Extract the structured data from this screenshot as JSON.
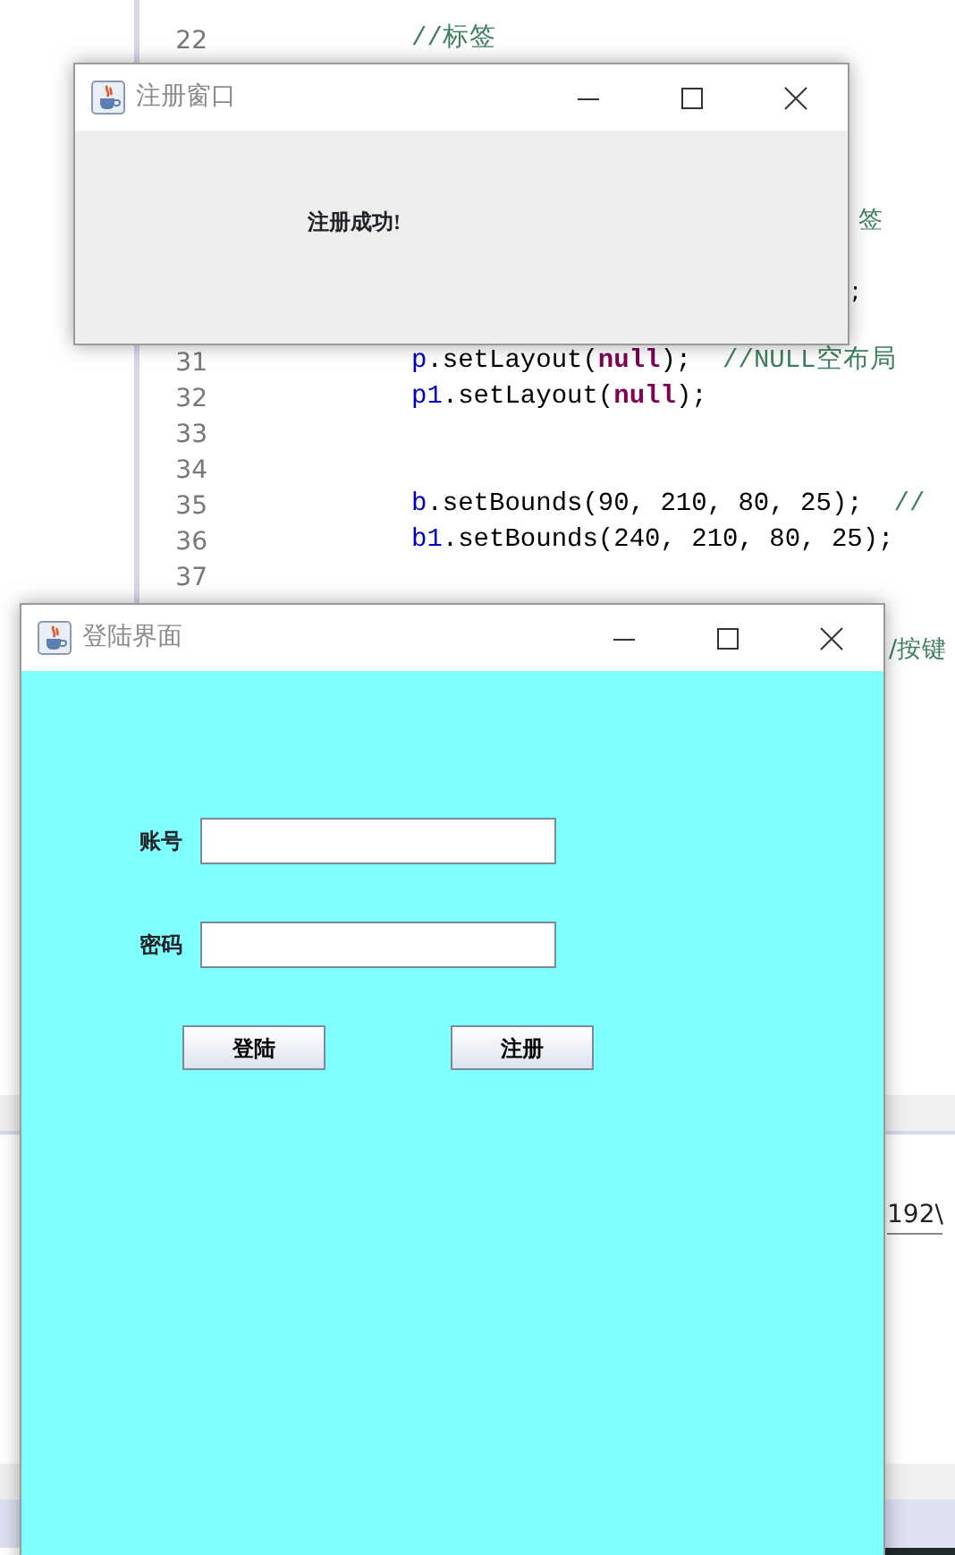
{
  "editor": {
    "lines": [
      {
        "number": "22",
        "tokens": [
          {
            "kind": "comment",
            "text": "//标签"
          }
        ]
      },
      {
        "number": "31",
        "tokens": [
          {
            "kind": "var",
            "text": "p"
          },
          {
            "kind": "plain",
            "text": ".setLayout("
          },
          {
            "kind": "kw",
            "text": "null"
          },
          {
            "kind": "plain",
            "text": ");  "
          },
          {
            "kind": "comment",
            "text": "//NULL空布局"
          }
        ]
      },
      {
        "number": "32",
        "tokens": [
          {
            "kind": "var",
            "text": "p1"
          },
          {
            "kind": "plain",
            "text": ".setLayout("
          },
          {
            "kind": "kw",
            "text": "null"
          },
          {
            "kind": "plain",
            "text": ");"
          }
        ]
      },
      {
        "number": "33"
      },
      {
        "number": "34"
      },
      {
        "number": "35",
        "tokens": [
          {
            "kind": "var",
            "text": "b"
          },
          {
            "kind": "plain",
            "text": ".setBounds(90, 210, 80, 25);  "
          },
          {
            "kind": "comment",
            "text": "//"
          }
        ]
      },
      {
        "number": "36",
        "tokens": [
          {
            "kind": "var",
            "text": "b1"
          },
          {
            "kind": "plain",
            "text": ".setBounds(240, 210, 80, 25);"
          }
        ]
      },
      {
        "number": "37"
      }
    ],
    "fragments": [
      {
        "kind": "comment",
        "text": "签"
      },
      {
        "kind": "plain",
        "text": ";"
      },
      {
        "kind": "comment",
        "text": "/按键"
      }
    ]
  },
  "console": {
    "path": "192\\"
  },
  "windows": [
    {
      "kind": "dialog",
      "title": "注册窗口",
      "message": "注册成功!"
    },
    {
      "kind": "login",
      "title": "登陆界面",
      "fields": [
        {
          "label": "账号"
        },
        {
          "label": "密码"
        }
      ],
      "buttons": [
        "登陆",
        "注册"
      ]
    }
  ]
}
